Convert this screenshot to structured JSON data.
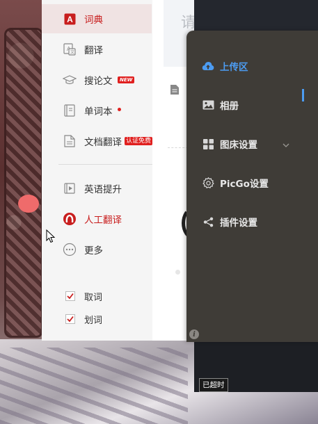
{
  "dict_app": {
    "nav": [
      {
        "label": "词典",
        "icon": "dictionary-icon",
        "active": true
      },
      {
        "label": "翻译",
        "icon": "translate-icon"
      },
      {
        "label": "搜论文",
        "icon": "graduation-cap-icon",
        "badge": "NEW"
      },
      {
        "label": "单词本",
        "icon": "notebook-icon",
        "dot": true
      },
      {
        "label": "文档翻译",
        "icon": "document-icon",
        "badge": "认证免费"
      },
      {
        "label": "英语提升",
        "icon": "video-play-icon"
      },
      {
        "label": "人工翻译",
        "icon": "human-translate-icon"
      },
      {
        "label": "更多",
        "icon": "more-icon"
      }
    ],
    "options": [
      {
        "label": "取词",
        "checked": true
      },
      {
        "label": "划词",
        "checked": true
      }
    ],
    "search_placeholder": "请输"
  },
  "picgo": {
    "menu": [
      {
        "label": "上传区",
        "icon": "cloud-upload-icon",
        "active": true
      },
      {
        "label": "相册",
        "icon": "image-icon"
      },
      {
        "label": "图床设置",
        "icon": "grid-icon",
        "expandable": true
      },
      {
        "label": "PicGo设置",
        "icon": "gear-icon"
      },
      {
        "label": "插件设置",
        "icon": "share-icon"
      }
    ],
    "info_icon": "i",
    "tooltip": "已超时"
  },
  "colors": {
    "dict_accent": "#c81e1e",
    "picgo_bg": "#3f3c37",
    "picgo_active": "#4c9cf2"
  }
}
